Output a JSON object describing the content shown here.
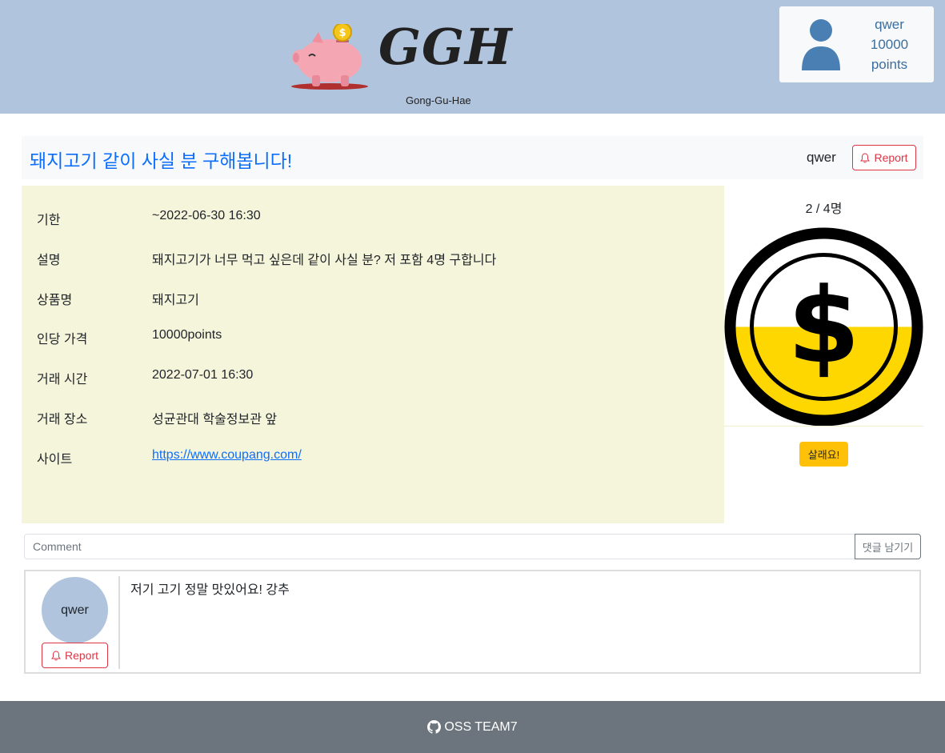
{
  "header": {
    "logo_text": "GGH",
    "logo_subtitle": "Gong-Gu-Hae",
    "logo_icon": "piggy-bank-icon",
    "user": {
      "name": "qwer",
      "points": "10000",
      "points_unit": "points",
      "avatar_icon": "person-icon"
    }
  },
  "post": {
    "title": "돼지고기 같이 사실 분 구해봅니다!",
    "author": "qwer",
    "report_label": "Report",
    "report_icon": "bell-icon",
    "details": [
      {
        "label": "기한",
        "value": "~2022-06-30 16:30"
      },
      {
        "label": "설명",
        "value": "돼지고기가 너무 먹고 싶은데 같이 사실 분? 저 포함 4명 구합니다"
      },
      {
        "label": "상품명",
        "value": "돼지고기"
      },
      {
        "label": "인당 가격",
        "value": "10000points"
      },
      {
        "label": "거래 시간",
        "value": "2022-07-01 16:30"
      },
      {
        "label": "거래 장소",
        "value": "성균관대 학술정보관 앞"
      },
      {
        "label": "사이트",
        "value": "https://www.coupang.com/"
      }
    ]
  },
  "progress": {
    "count_text": "2 / 4명",
    "current": 2,
    "total": 4,
    "fill_fraction": 0.5,
    "fill_color": "#ffd700",
    "coin_icon": "dollar-coin-icon",
    "buy_label": "살래요!"
  },
  "comments": {
    "placeholder": "Comment",
    "submit_label": "댓글 남기기",
    "items": [
      {
        "author": "qwer",
        "text": "저기 고기 정말 맛있어요! 강추",
        "report_label": "Report"
      }
    ]
  },
  "footer": {
    "text": "OSS TEAM7",
    "icon": "github-icon"
  },
  "colors": {
    "header_bg": "#b0c4de",
    "details_bg": "#f5f5dc",
    "title_color": "#0d6efd",
    "report_color": "#dc3545",
    "buy_button": "#ffc107",
    "footer_bg": "#6c757d"
  }
}
